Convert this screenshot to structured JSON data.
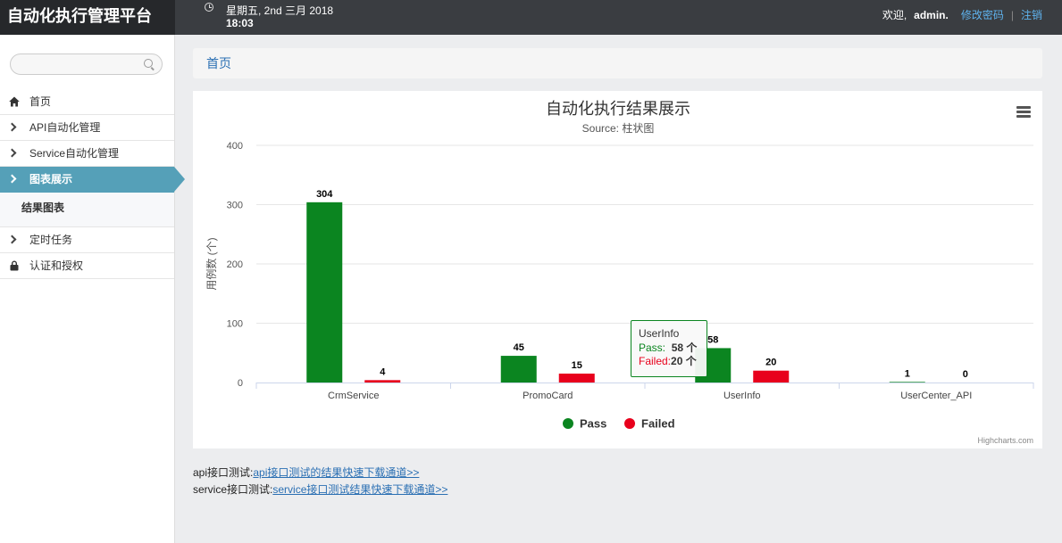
{
  "app": {
    "title": "自动化执行管理平台"
  },
  "header": {
    "date": "星期五, 2nd 三月 2018",
    "time": "18:03",
    "welcome": "欢迎,",
    "username": "admin.",
    "change_password": "修改密码",
    "separator": "|",
    "logout": "注销"
  },
  "sidebar": {
    "search_placeholder": "",
    "items": [
      {
        "label": "首页",
        "icon": "home-icon"
      },
      {
        "label": "API自动化管理",
        "icon": "chevron-right-icon"
      },
      {
        "label": "Service自动化管理",
        "icon": "chevron-right-icon"
      },
      {
        "label": "图表展示",
        "icon": "chevron-right-icon",
        "active": true
      },
      {
        "label": "定时任务",
        "icon": "chevron-right-icon"
      },
      {
        "label": "认证和授权",
        "icon": "lock-icon"
      }
    ],
    "sub_items": [
      {
        "label": "结果图表"
      }
    ]
  },
  "breadcrumb": {
    "home": "首页"
  },
  "chart_data": {
    "type": "bar",
    "title": "自动化执行结果展示",
    "subtitle": "Source: 柱状图",
    "ylabel": "用例数 (个)",
    "xlabel": "",
    "ylim": [
      0,
      400
    ],
    "yticks": [
      0,
      100,
      200,
      300,
      400
    ],
    "categories": [
      "CrmService",
      "PromoCard",
      "UserInfo",
      "UserCenter_API"
    ],
    "series": [
      {
        "name": "Pass",
        "color": "#0b8520",
        "values": [
          304,
          45,
          58,
          1
        ]
      },
      {
        "name": "Failed",
        "color": "#e8001c",
        "values": [
          4,
          15,
          20,
          0
        ]
      }
    ],
    "legend_position": "bottom-center",
    "grid": true,
    "credits": "Highcharts.com",
    "tooltip": {
      "title": "UserInfo",
      "pass_label": "Pass:",
      "pass_value": "58 个",
      "fail_label": "Failed:",
      "fail_value": "20 个"
    }
  },
  "links": [
    {
      "label": "api接口测试:",
      "text": "api接口测试的结果快速下载通道>>"
    },
    {
      "label": "service接口测试:",
      "text": "service接口测试结果快速下载通道>>"
    }
  ],
  "colors": {
    "accent": "#55a0b8",
    "topbar": "#3a3d41",
    "pass": "#0b8520",
    "failed": "#e8001c",
    "link": "#5fb3ee"
  }
}
